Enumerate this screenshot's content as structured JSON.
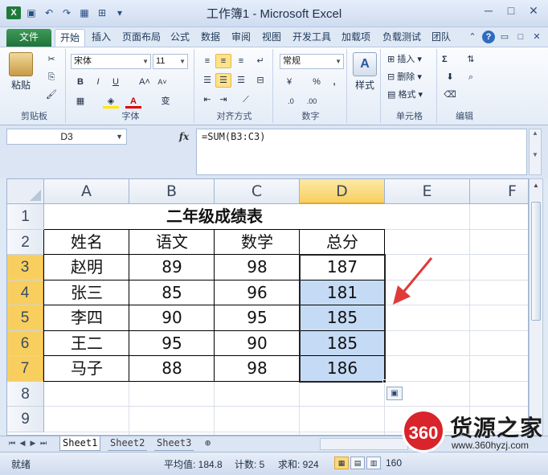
{
  "window": {
    "title": "工作簿1 - Microsoft Excel",
    "controls": [
      "─",
      "□",
      "✕"
    ]
  },
  "ribbon_tabs": [
    "文件",
    "开始",
    "插入",
    "页面布局",
    "公式",
    "数据",
    "审阅",
    "视图",
    "开发工具",
    "加载项",
    "负载测试",
    "团队"
  ],
  "ribbon": {
    "clipboard": {
      "label": "剪贴板",
      "paste": "粘贴"
    },
    "font": {
      "label": "字体",
      "name": "宋体",
      "size": "11",
      "bold": "B",
      "italic": "I",
      "underline": "U",
      "grow": "A˄",
      "shrink": "A˅",
      "wen": "变"
    },
    "alignment": {
      "label": "对齐方式"
    },
    "number": {
      "label": "数字",
      "format": "常规",
      "percent": "%",
      "comma": ","
    },
    "styles": {
      "label": "样式"
    },
    "cells": {
      "label": "单元格",
      "insert": "插入",
      "delete": "删除",
      "format": "格式"
    },
    "editing": {
      "label": "编辑",
      "sum": "Σ"
    }
  },
  "formula_bar": {
    "name_box": "D3",
    "fx": "fx",
    "formula": "=SUM(B3:C3)"
  },
  "grid": {
    "columns": [
      "A",
      "B",
      "C",
      "D",
      "E",
      "F"
    ],
    "rows": [
      "1",
      "2",
      "3",
      "4",
      "5",
      "6",
      "7",
      "8",
      "9"
    ],
    "title": "二年级成绩表",
    "headers": [
      "姓名",
      "语文",
      "数学",
      "总分"
    ],
    "data": [
      [
        "赵明",
        "89",
        "98",
        "187"
      ],
      [
        "张三",
        "85",
        "96",
        "181"
      ],
      [
        "李四",
        "90",
        "95",
        "185"
      ],
      [
        "王二",
        "95",
        "90",
        "185"
      ],
      [
        "马子",
        "88",
        "98",
        "186"
      ]
    ],
    "active_cell": "D3",
    "selected_range": "D3:D7"
  },
  "sheets": [
    "Sheet1",
    "Sheet2",
    "Sheet3"
  ],
  "status": {
    "ready": "就绪",
    "average": "平均值: 184.8",
    "count": "计数: 5",
    "sum": "求和: 924",
    "zoom": "160"
  },
  "watermark": {
    "badge": "360",
    "name": "货源之家",
    "url": "www.360hyzj.com"
  },
  "colors": {
    "selection_header": "#f8cf5f",
    "selection_fill": "#c5dbf5",
    "arrow": "#e03a3a",
    "file_tab": "#2a8445"
  }
}
